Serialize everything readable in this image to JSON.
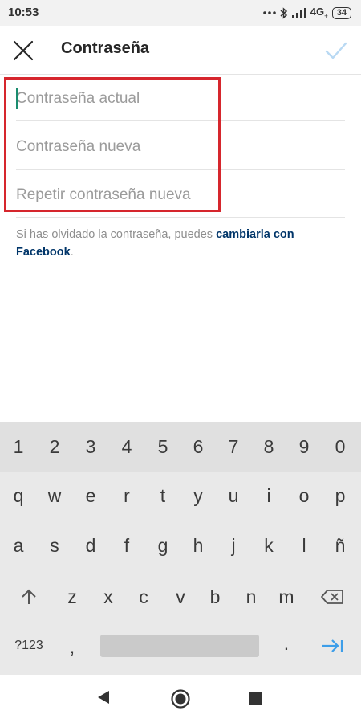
{
  "status_bar": {
    "time": "10:53",
    "network": "4G",
    "network_sub": "+",
    "battery": "34",
    "icons": [
      "dots-icon",
      "bluetooth-icon",
      "signal-icon",
      "battery-icon"
    ]
  },
  "app_bar": {
    "title": "Contraseña",
    "close_icon": "close-icon",
    "confirm_icon": "check-icon",
    "confirm_color": "#b9d9f3"
  },
  "form": {
    "current_password_placeholder": "Contraseña actual",
    "new_password_placeholder": "Contraseña nueva",
    "repeat_password_placeholder": "Repetir contraseña nueva",
    "highlight_color": "#d6262d",
    "cursor_color": "#1a8c6e"
  },
  "help": {
    "text": "Si has olvidado la contraseña, puedes ",
    "link": "cambiarla con Facebook",
    "suffix": ".",
    "link_color": "#003569"
  },
  "keyboard": {
    "numbers": [
      "1",
      "2",
      "3",
      "4",
      "5",
      "6",
      "7",
      "8",
      "9",
      "0"
    ],
    "row1": [
      "q",
      "w",
      "e",
      "r",
      "t",
      "y",
      "u",
      "i",
      "o",
      "p"
    ],
    "row2": [
      "a",
      "s",
      "d",
      "f",
      "g",
      "h",
      "j",
      "k",
      "l",
      "ñ"
    ],
    "row3": [
      "z",
      "x",
      "c",
      "v",
      "b",
      "n",
      "m"
    ],
    "symbols_label": "?123",
    "comma": ",",
    "period": ".",
    "shift_icon": "shift-arrow-icon",
    "backspace_icon": "backspace-icon",
    "next_icon": "tab-next-icon",
    "accent_color": "#3d9ee9"
  },
  "nav_bar": {
    "icons": [
      "back-triangle-icon",
      "home-circle-icon",
      "recents-square-icon"
    ]
  }
}
